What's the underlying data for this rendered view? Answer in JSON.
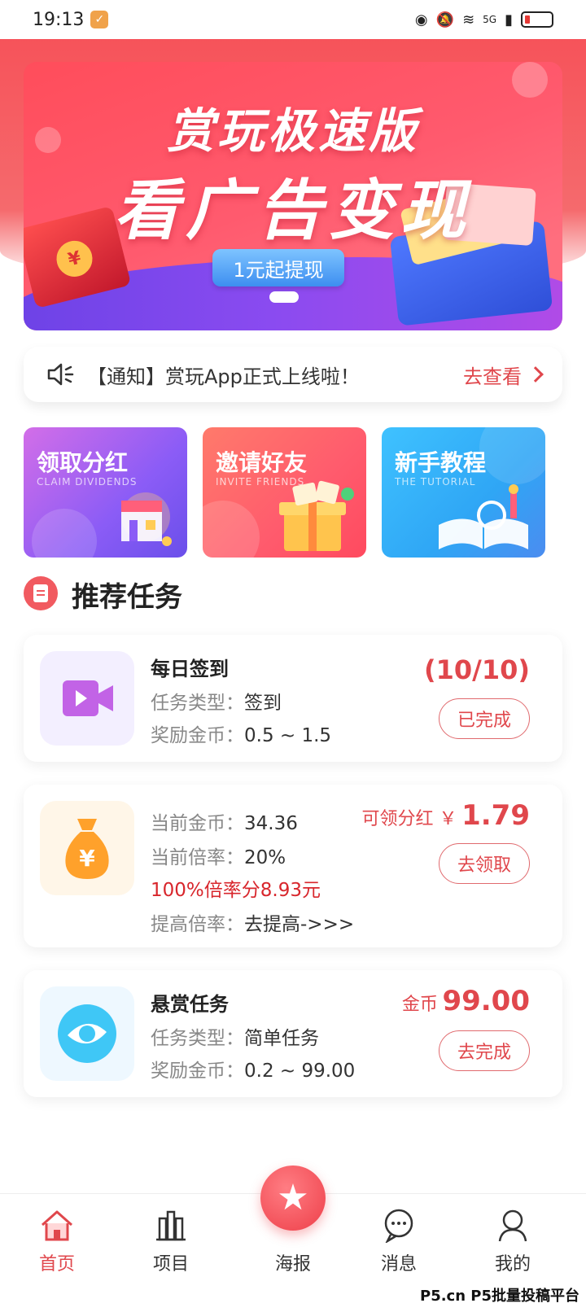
{
  "status_bar": {
    "time": "19:13",
    "network": "5G"
  },
  "banner": {
    "title_line1": "赏玩极速版",
    "title_line2": "看广告变现",
    "pill": "1元起提现",
    "envelope_coin": "¥"
  },
  "notice": {
    "text": "【通知】赏玩App正式上线啦！",
    "link": "去查看"
  },
  "features": [
    {
      "title": "领取分红",
      "subtitle": "CLAIM DIVIDENDS"
    },
    {
      "title": "邀请好友",
      "subtitle": "INVITE FRIENDS"
    },
    {
      "title": "新手教程",
      "subtitle": "THE TUTORIAL"
    }
  ],
  "section": {
    "title": "推荐任务"
  },
  "tasks": {
    "daily": {
      "name": "每日签到",
      "type_label": "任务类型：",
      "type_value": "签到",
      "reward_label": "奖励金币：",
      "reward_value": "0.5 ~ 1.5",
      "progress": "(10/10)",
      "button": "已完成"
    },
    "dividend": {
      "coin_label": "当前金币：",
      "coin_value": "34.36",
      "rate_label": "当前倍率：",
      "rate_value": "20%",
      "full_rate": "100%倍率分8.93元",
      "boost_label": "提高倍率：",
      "boost_value": "去提高->>>",
      "claim_label": "可领分红 ￥",
      "claim_value": "1.79",
      "button": "去领取",
      "icon_glyph": "¥"
    },
    "bounty": {
      "name": "悬赏任务",
      "type_label": "任务类型：",
      "type_value": "简单任务",
      "reward_label": "奖励金币：",
      "reward_value": "0.2 ~ 99.00",
      "coin_label": "金币",
      "coin_value": "99.00",
      "button": "去完成"
    }
  },
  "nav": {
    "home": "首页",
    "projects": "项目",
    "poster": "海报",
    "messages": "消息",
    "mine": "我的"
  },
  "watermark": "P5.cn P5批量投稿平台",
  "colors": {
    "accent": "#e0474c",
    "banner": "#ff4d5b",
    "purple": "#8b5cf6",
    "blue": "#2fa6f5"
  }
}
